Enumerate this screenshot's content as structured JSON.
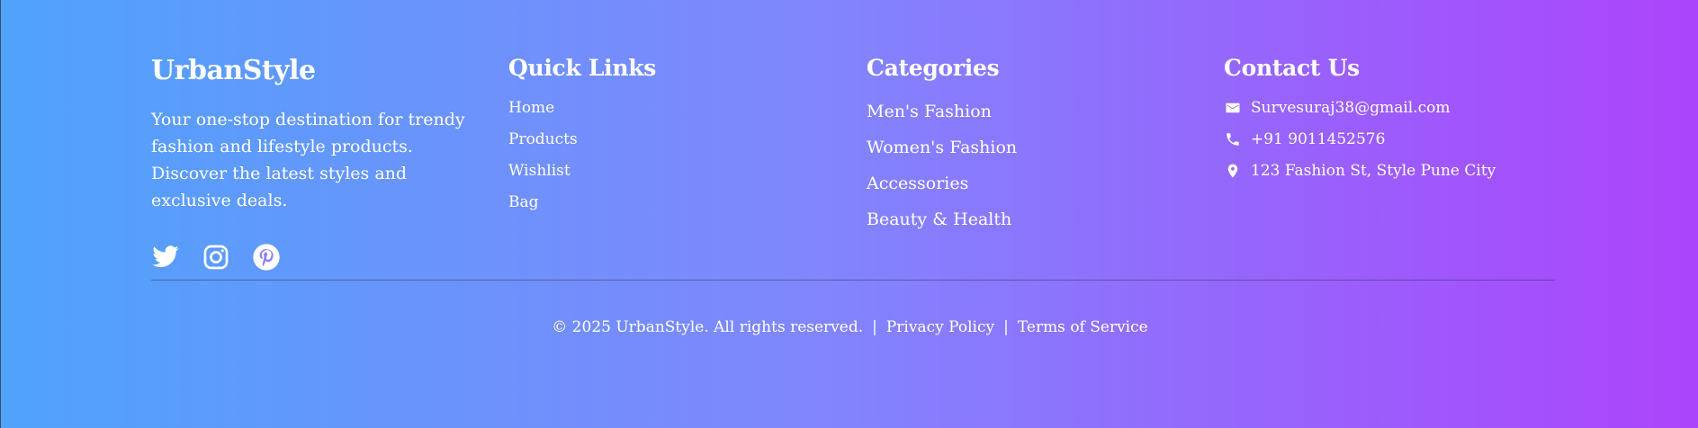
{
  "brand": {
    "title": "UrbanStyle",
    "description": "Your one-stop destination for trendy fashion and lifestyle products. Discover the latest styles and exclusive deals.",
    "socials": [
      {
        "icon": "twitter-icon"
      },
      {
        "icon": "instagram-icon"
      },
      {
        "icon": "pinterest-icon"
      }
    ]
  },
  "quick_links": {
    "title": "Quick Links",
    "items": [
      {
        "label": "Home"
      },
      {
        "label": "Products"
      },
      {
        "label": "Wishlist"
      },
      {
        "label": "Bag"
      }
    ]
  },
  "categories": {
    "title": "Categories",
    "items": [
      {
        "label": "Men's Fashion"
      },
      {
        "label": "Women's Fashion"
      },
      {
        "label": "Accessories"
      },
      {
        "label": "Beauty & Health"
      }
    ]
  },
  "contact": {
    "title": "Contact Us",
    "email": {
      "icon": "mail-icon",
      "text": "Survesuraj38@gmail.com"
    },
    "phone": {
      "icon": "phone-icon",
      "text": "+91 9011452576"
    },
    "address": {
      "icon": "location-pin-icon",
      "text": "123 Fashion St, Style Pune City"
    }
  },
  "bottom": {
    "copyright": "© 2025 UrbanStyle. All rights reserved.",
    "separator": "|",
    "privacy": "Privacy Policy",
    "terms": "Terms of Service"
  },
  "colors": {
    "gradient_start": "#4fa3fb",
    "gradient_mid": "#8186fd",
    "gradient_end": "#ac44fc",
    "text": "#ffffff"
  }
}
